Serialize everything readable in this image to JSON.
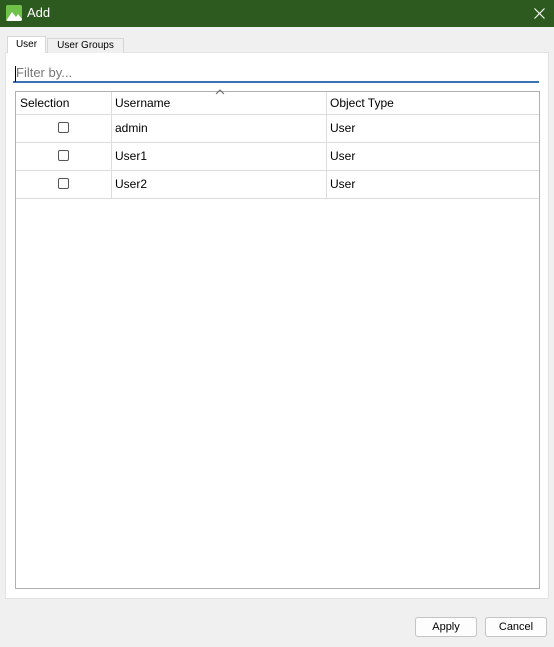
{
  "window": {
    "title": "Add",
    "close_icon": "close-icon"
  },
  "tabs": [
    {
      "label": "User",
      "active": true
    },
    {
      "label": "User Groups",
      "active": false
    }
  ],
  "filter": {
    "placeholder": "Filter by...",
    "value": ""
  },
  "table": {
    "columns": [
      "Selection",
      "Username",
      "Object Type"
    ],
    "sorted_column": "Username",
    "rows": [
      {
        "selected": false,
        "username": "admin",
        "object_type": "User"
      },
      {
        "selected": false,
        "username": "User1",
        "object_type": "User"
      },
      {
        "selected": false,
        "username": "User2",
        "object_type": "User"
      }
    ]
  },
  "buttons": {
    "apply": "Apply",
    "cancel": "Cancel"
  },
  "colors": {
    "titlebar": "#2d5a1e",
    "focus_underline": "#3a73b5"
  }
}
